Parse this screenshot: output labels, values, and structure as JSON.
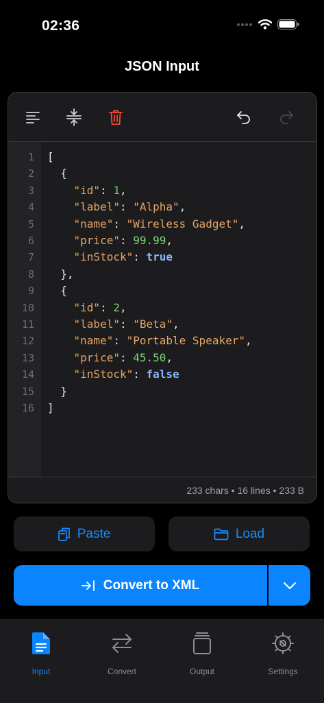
{
  "status": {
    "time": "02:36"
  },
  "header": {
    "title": "JSON Input"
  },
  "toolbar": {
    "icons": [
      "format-icon",
      "compress-icon",
      "trash-icon",
      "undo-icon",
      "redo-icon"
    ]
  },
  "editor": {
    "line_numbers": [
      "1",
      "2",
      "3",
      "4",
      "5",
      "6",
      "7",
      "8",
      "9",
      "10",
      "11",
      "12",
      "13",
      "14",
      "15",
      "16"
    ],
    "lines": [
      [
        {
          "t": "p",
          "v": "["
        }
      ],
      [
        {
          "t": "p",
          "v": "  {"
        }
      ],
      [
        {
          "t": "k",
          "v": "    \"id\""
        },
        {
          "t": "p",
          "v": ": "
        },
        {
          "t": "n",
          "v": "1"
        },
        {
          "t": "p",
          "v": ","
        }
      ],
      [
        {
          "t": "k",
          "v": "    \"label\""
        },
        {
          "t": "p",
          "v": ": "
        },
        {
          "t": "s",
          "v": "\"Alpha\""
        },
        {
          "t": "p",
          "v": ","
        }
      ],
      [
        {
          "t": "k",
          "v": "    \"name\""
        },
        {
          "t": "p",
          "v": ": "
        },
        {
          "t": "s",
          "v": "\"Wireless Gadget\""
        },
        {
          "t": "p",
          "v": ","
        }
      ],
      [
        {
          "t": "k",
          "v": "    \"price\""
        },
        {
          "t": "p",
          "v": ": "
        },
        {
          "t": "n",
          "v": "99.99"
        },
        {
          "t": "p",
          "v": ","
        }
      ],
      [
        {
          "t": "k",
          "v": "    \"inStock\""
        },
        {
          "t": "p",
          "v": ": "
        },
        {
          "t": "b",
          "v": "true"
        }
      ],
      [
        {
          "t": "p",
          "v": "  },"
        }
      ],
      [
        {
          "t": "p",
          "v": "  {"
        }
      ],
      [
        {
          "t": "k",
          "v": "    \"id\""
        },
        {
          "t": "p",
          "v": ": "
        },
        {
          "t": "n",
          "v": "2"
        },
        {
          "t": "p",
          "v": ","
        }
      ],
      [
        {
          "t": "k",
          "v": "    \"label\""
        },
        {
          "t": "p",
          "v": ": "
        },
        {
          "t": "s",
          "v": "\"Beta\""
        },
        {
          "t": "p",
          "v": ","
        }
      ],
      [
        {
          "t": "k",
          "v": "    \"name\""
        },
        {
          "t": "p",
          "v": ": "
        },
        {
          "t": "s",
          "v": "\"Portable Speaker\""
        },
        {
          "t": "p",
          "v": ","
        }
      ],
      [
        {
          "t": "k",
          "v": "    \"price\""
        },
        {
          "t": "p",
          "v": ": "
        },
        {
          "t": "n",
          "v": "45.50"
        },
        {
          "t": "p",
          "v": ","
        }
      ],
      [
        {
          "t": "k",
          "v": "    \"inStock\""
        },
        {
          "t": "p",
          "v": ": "
        },
        {
          "t": "b",
          "v": "false"
        }
      ],
      [
        {
          "t": "p",
          "v": "  }"
        }
      ],
      [
        {
          "t": "p",
          "v": "]"
        }
      ]
    ],
    "stats": "233 chars • 16 lines • 233 B"
  },
  "actions": {
    "paste_label": "Paste",
    "load_label": "Load",
    "convert_label": "Convert to XML"
  },
  "tabs": [
    {
      "label": "Input",
      "icon": "document-icon",
      "active": true
    },
    {
      "label": "Convert",
      "icon": "arrows-icon",
      "active": false
    },
    {
      "label": "Output",
      "icon": "stack-icon",
      "active": false
    },
    {
      "label": "Settings",
      "icon": "gear-icon",
      "active": false
    }
  ],
  "colors": {
    "accent": "#0a84ff",
    "danger": "#ff453a",
    "background": "#000000",
    "surface": "#1c1c1e"
  }
}
